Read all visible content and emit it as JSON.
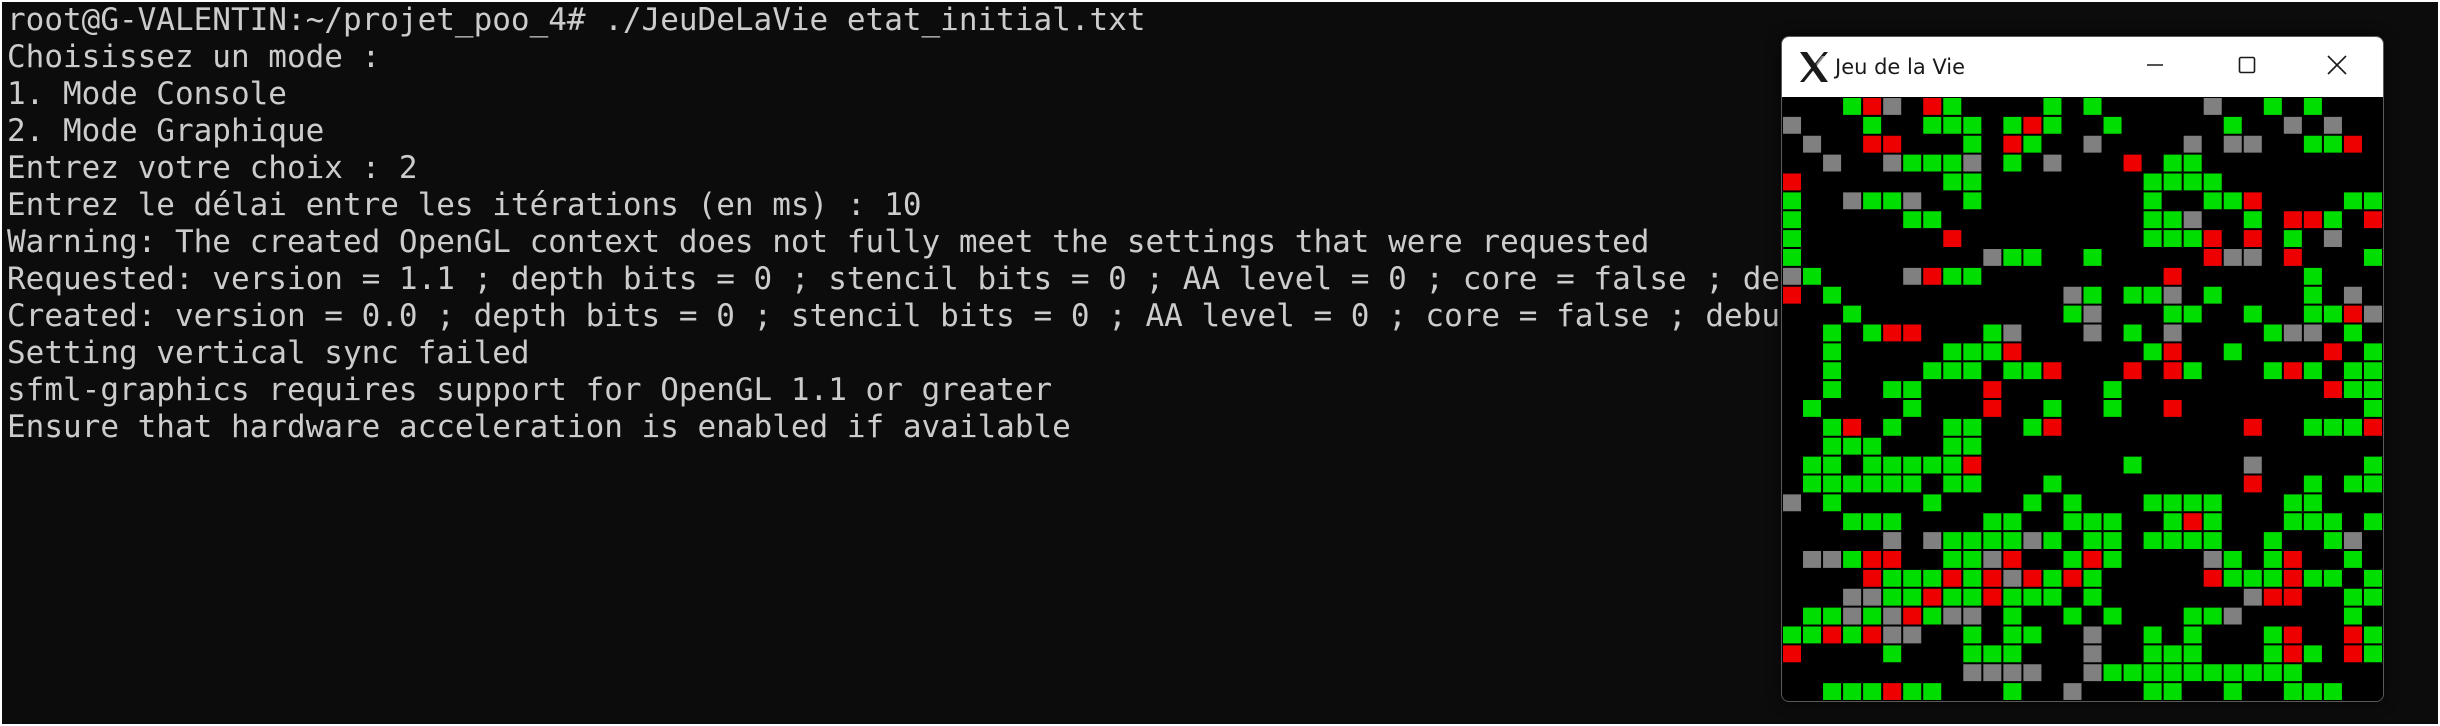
{
  "terminal": {
    "lines": [
      "root@G-VALENTIN:~/projet_poo_4# ./JeuDeLaVie etat_initial.txt",
      "Choisissez un mode :",
      "1. Mode Console",
      "2. Mode Graphique",
      "Entrez votre choix : 2",
      "Entrez le délai entre les itérations (en ms) : 10",
      "Warning: The created OpenGL context does not fully meet the settings that were requested",
      "Requested: version = 1.1 ; depth bits = 0 ; stencil bits = 0 ; AA level = 0 ; core = false ; debug = false ; sRGB = false",
      "Created: version = 0.0 ; depth bits = 0 ; stencil bits = 0 ; AA level = 0 ; core = false ; debug = false ; sRGB = false",
      "Setting vertical sync failed",
      "sfml-graphics requires support for OpenGL 1.1 or greater",
      "Ensure that hardware acceleration is enabled if available"
    ]
  },
  "window": {
    "title": "Jeu de la Vie",
    "icon": "x11-logo-icon",
    "controls": [
      "minimize-icon",
      "maximize-icon",
      "close-icon"
    ]
  },
  "grid": {
    "columns": 30,
    "rows": 30,
    "colors": {
      "G": "#00dd00",
      "R": "#ee0000",
      "D": "#808080",
      ".": "#000000"
    },
    "cells": [
      "...GRD.RG....G.G.....D..G.G...",
      "D...G..GGG.GRG..G.....G..D.D..",
      ".D..RR...G.RG..D....D.DD..GGR.",
      "..D..DGGGD.G.D...R.GG.........",
      "R.......GG........GGGG........",
      "G..DGGD..G........G..GGR....GG",
      "G.....GG..........GGD..G.RRG.R",
      "G.......R.........GGGR.R.G.D..",
      "G.........DGG..G.....RDD.R...G",
      "DG....DRGG.........R......G...",
      "R.G...........DG.GGD.G....G.D.",
      "...G..........GD...GG..G..GGRD",
      "..G.GRR...GD...D.G.D....GDD.G.",
      "..G.....GGGR......GR..G....R.G",
      "..G....GGG.GGR...R.RG...GRG.GG",
      "..G..GG...R.....G..........RGG",
      ".G....G...R..G..G..R.........G",
      "..GR.G..GG..GR.........R..GGGR",
      "..GGG...GG.....................",
      ".GG.GGGGGR.......G.....D.....G",
      ".GGGGGG.GG...G.........R..G.GG",
      "D.G....G....G.G...GGGG...GG...",
      "...GGG....GG..GGG..GRG...GGG.G",
      ".....D.DGGGGDG.GG.GGGG..G..GD.",
      ".DDGRR..GGDR..GRG....DG.GR..G.",
      "....RGGGRGRDRGRG.....RGGGRGG.G",
      "...DDGGRGGRGGG.G.......DRR..GG",
      ".GGDGDRGDD.G..G.G...GGD.....G.",
      "GGRGRDD..G.GG..D..G.G...GR..RG",
      "R....G...GGG...D..GGG...GRG.RG",
      ".........DDDD..DGGGGGGGGGG....",
      "..GGGRGG...G..D...GG..G..GGG.."
    ]
  }
}
